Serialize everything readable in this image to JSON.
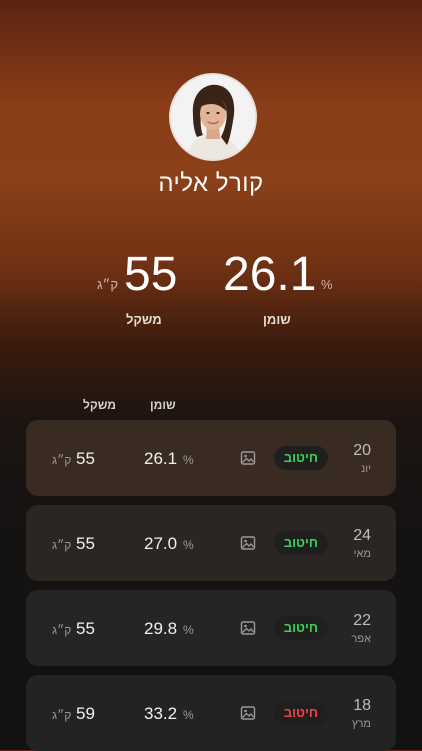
{
  "profile": {
    "name": "קורל אליה"
  },
  "stats": {
    "fat": {
      "value": "26.1",
      "unit": "%",
      "label": "שומן"
    },
    "weight": {
      "value": "55",
      "unit": "ק״ג",
      "label": "משקל"
    }
  },
  "columns": {
    "fat": "שומן",
    "weight": "משקל"
  },
  "colors": {
    "positive": "#3ecf5c",
    "negative": "#ef4444"
  },
  "entries": [
    {
      "day": "20",
      "month": "יונ",
      "badge": "חיטוב",
      "badge_status": "positive",
      "fat": "26.1",
      "fat_unit": "%",
      "weight": "55",
      "weight_unit": "ק״ג"
    },
    {
      "day": "24",
      "month": "מאי",
      "badge": "חיטוב",
      "badge_status": "positive",
      "fat": "27.0",
      "fat_unit": "%",
      "weight": "55",
      "weight_unit": "ק״ג"
    },
    {
      "day": "22",
      "month": "אפר",
      "badge": "חיטוב",
      "badge_status": "positive",
      "fat": "29.8",
      "fat_unit": "%",
      "weight": "55",
      "weight_unit": "ק״ג"
    },
    {
      "day": "18",
      "month": "מרץ",
      "badge": "חיטוב",
      "badge_status": "negative",
      "fat": "33.2",
      "fat_unit": "%",
      "weight": "59",
      "weight_unit": "ק״ג"
    }
  ]
}
